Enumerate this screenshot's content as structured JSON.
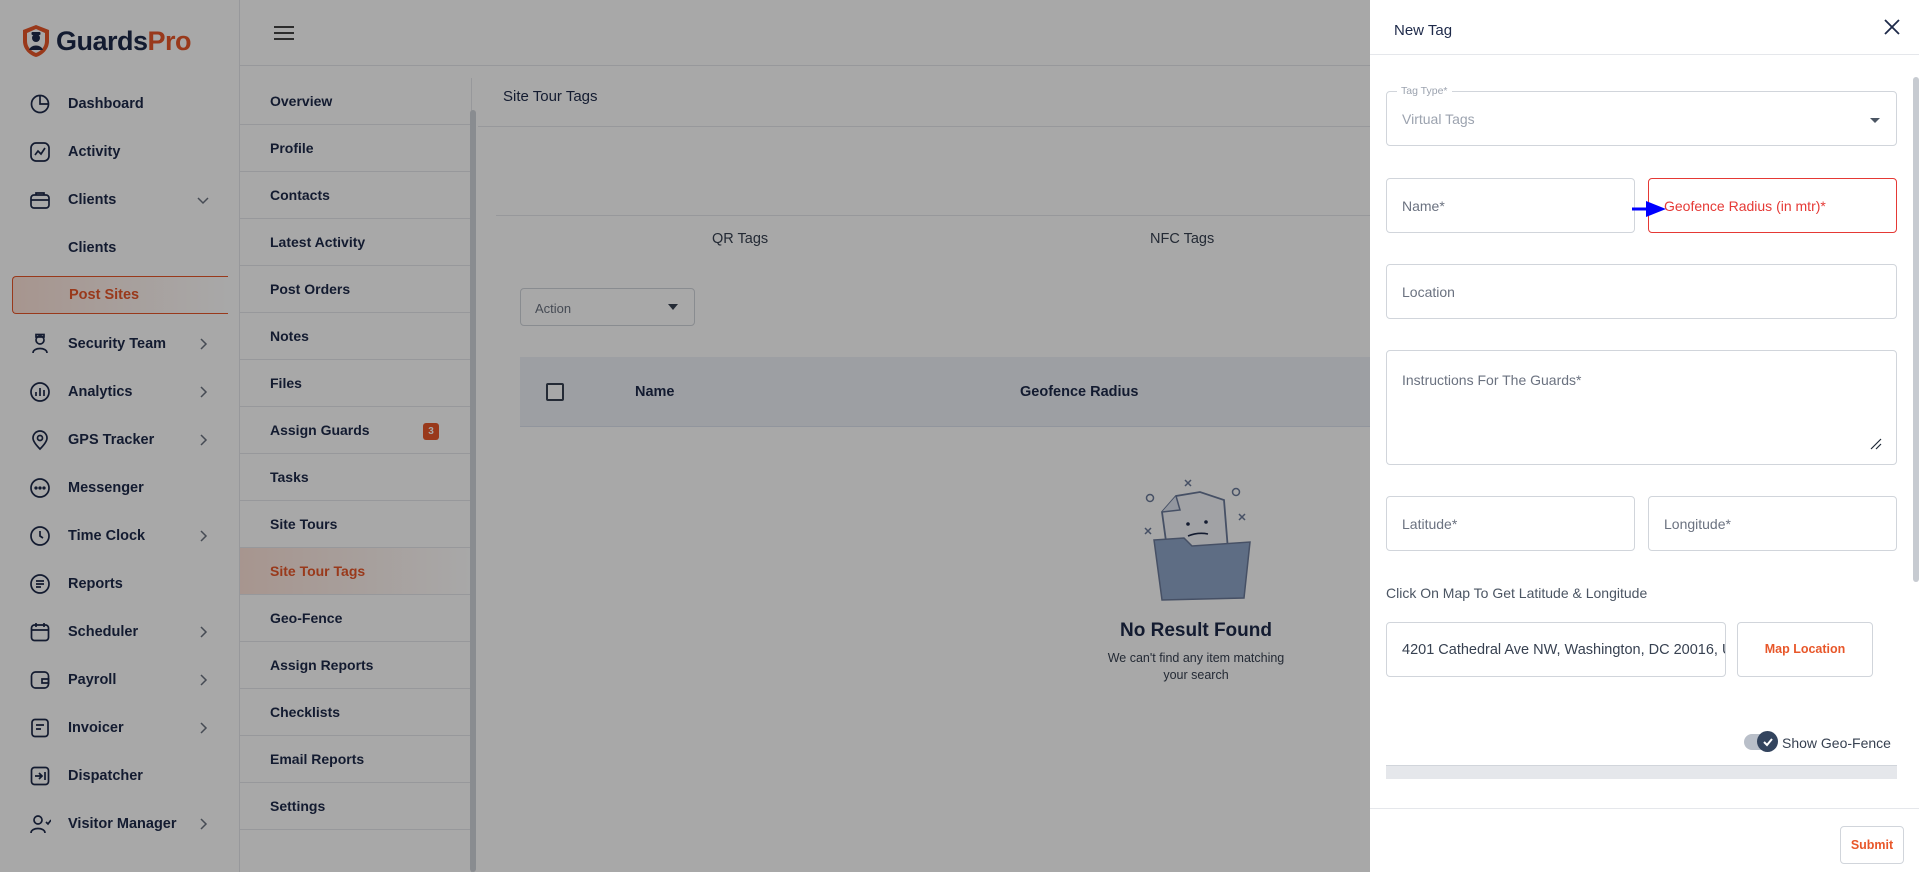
{
  "brand": {
    "name_main": "Guards",
    "name_accent": "Pro",
    "accent_color": "#e8572a",
    "navy_color": "#1e2a4a"
  },
  "sidebar": {
    "items": [
      {
        "label": "Dashboard",
        "icon": "dashboard-icon"
      },
      {
        "label": "Activity",
        "icon": "activity-icon"
      },
      {
        "label": "Clients",
        "icon": "clients-icon",
        "expanded": true
      },
      {
        "label": "Security Team",
        "icon": "security-team-icon"
      },
      {
        "label": "Analytics",
        "icon": "analytics-icon"
      },
      {
        "label": "GPS Tracker",
        "icon": "gps-tracker-icon"
      },
      {
        "label": "Messenger",
        "icon": "messenger-icon"
      },
      {
        "label": "Time Clock",
        "icon": "time-clock-icon"
      },
      {
        "label": "Reports",
        "icon": "reports-icon"
      },
      {
        "label": "Scheduler",
        "icon": "scheduler-icon"
      },
      {
        "label": "Payroll",
        "icon": "payroll-icon"
      },
      {
        "label": "Invoicer",
        "icon": "invoicer-icon"
      },
      {
        "label": "Dispatcher",
        "icon": "dispatcher-icon"
      },
      {
        "label": "Visitor Manager",
        "icon": "visitor-manager-icon"
      }
    ],
    "clients_sub": [
      "Clients",
      "Post Sites"
    ]
  },
  "submenu": {
    "items": [
      "Overview",
      "Profile",
      "Contacts",
      "Latest Activity",
      "Post Orders",
      "Notes",
      "Files",
      "Assign Guards",
      "Tasks",
      "Site Tours",
      "Site Tour Tags",
      "Geo-Fence",
      "Assign Reports",
      "Checklists",
      "Email Reports",
      "Settings"
    ],
    "assign_guards_badge": "3",
    "active": "Site Tour Tags"
  },
  "content": {
    "title": "Site Tour Tags",
    "tabs": [
      "QR Tags",
      "NFC Tags"
    ],
    "action_label": "Action",
    "table_headers": [
      "Name",
      "Geofence Radius"
    ],
    "empty_title": "No Result Found",
    "empty_sub": "We can't find any item matching your search"
  },
  "drawer": {
    "title": "New Tag",
    "tag_type_label": "Tag Type*",
    "tag_type_value": "Virtual Tags",
    "name_placeholder": "Name*",
    "geofence_placeholder": "Geofence Radius (in mtr)*",
    "location_placeholder": "Location",
    "instructions_placeholder": "Instructions For The Guards*",
    "latitude_placeholder": "Latitude*",
    "longitude_placeholder": "Longitude*",
    "map_helper": "Click On Map To Get Latitude & Longitude",
    "address_value": "4201 Cathedral Ave NW, Washington, DC 20016, U",
    "map_location_label": "Map Location",
    "show_geofence_label": "Show Geo-Fence",
    "show_geofence_on": true,
    "submit_label": "Submit"
  }
}
